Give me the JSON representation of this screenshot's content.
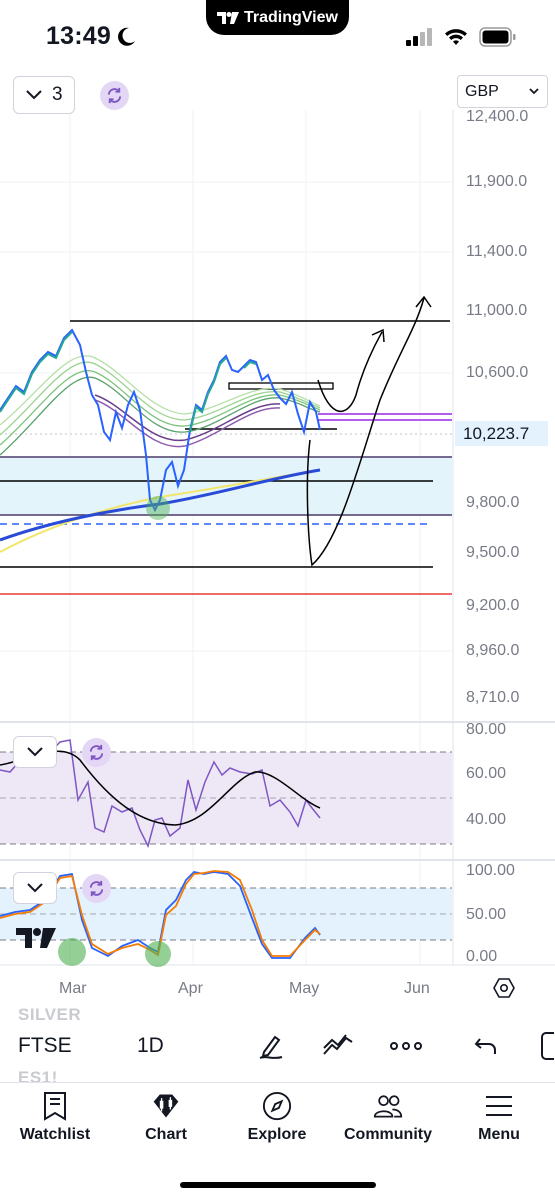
{
  "status": {
    "time": "13:49",
    "app_name": "TradingView"
  },
  "chart": {
    "interval_count": "3",
    "currency": "GBP",
    "last_price": "10,223.7",
    "price_ticks": [
      "12,400.0",
      "11,900.0",
      "11,400.0",
      "11,000.0",
      "10,600.0",
      "9,800.0",
      "9,500.0",
      "9,200.0",
      "8,960.0",
      "8,710.0"
    ],
    "rsi_ticks": [
      "80.00",
      "60.00",
      "40.00"
    ],
    "stoch_ticks": [
      "100.00",
      "50.00",
      "0.00"
    ],
    "months": [
      "Mar",
      "Apr",
      "May",
      "Jun"
    ],
    "colors": {
      "up": "#26a69a",
      "down": "#2962ff",
      "ma_long": "#2a4bd7",
      "ma_yellow": "#f2e56a",
      "ribbon": "#7cc47a",
      "purple": "#7e57c2",
      "resistance": "#b35cf0",
      "red_line": "#e53935"
    }
  },
  "ghost": {
    "above": "SILVER",
    "below": "ES1!"
  },
  "toolbar": {
    "symbol": "FTSE",
    "timeframe": "1D",
    "icons": [
      "pen-icon",
      "drawings-icon",
      "more-icon",
      "undo-icon",
      "layout-icon"
    ]
  },
  "tabs": [
    {
      "label": "Watchlist",
      "icon": "watchlist-icon"
    },
    {
      "label": "Chart",
      "icon": "chart-icon"
    },
    {
      "label": "Explore",
      "icon": "compass-icon"
    },
    {
      "label": "Community",
      "icon": "community-icon"
    },
    {
      "label": "Menu",
      "icon": "menu-icon"
    }
  ]
}
